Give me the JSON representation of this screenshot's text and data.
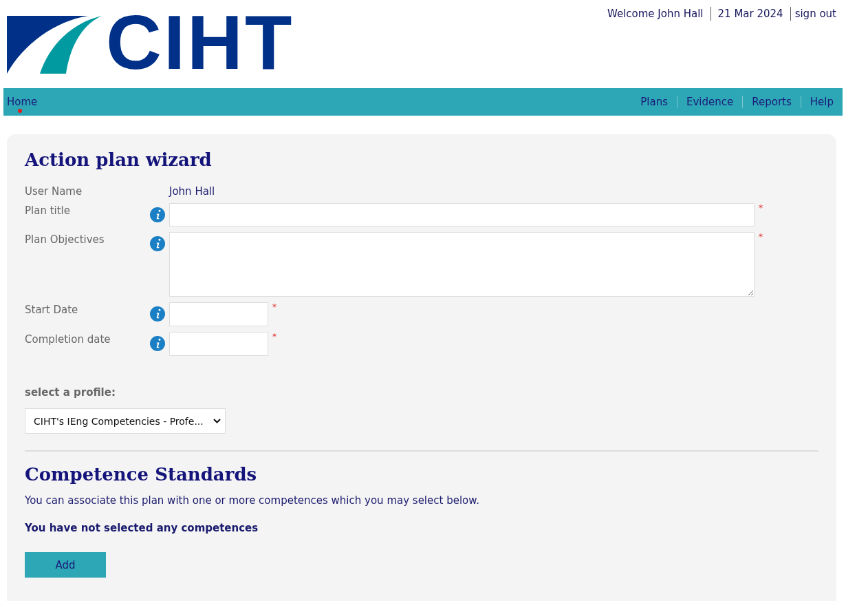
{
  "logo": {
    "text": "CIHT"
  },
  "header": {
    "welcome": "Welcome John Hall",
    "date": "21 Mar 2024",
    "sign_out": "sign out"
  },
  "nav": {
    "left": [
      {
        "label": "Home",
        "selected": true
      }
    ],
    "right": [
      {
        "label": "Plans",
        "selected": false
      },
      {
        "label": "Evidence",
        "selected": false
      },
      {
        "label": "Reports",
        "selected": false
      },
      {
        "label": "Help",
        "selected": false
      }
    ]
  },
  "form": {
    "title": "Action plan wizard",
    "user": {
      "label": "User Name",
      "value": "John Hall"
    },
    "fields": [
      {
        "label": "Plan title",
        "kind": "text",
        "required_mark": "*"
      },
      {
        "label": "Plan Objectives",
        "kind": "textarea",
        "required_mark": "*"
      },
      {
        "label": "Start Date",
        "kind": "date",
        "required_mark": "*"
      },
      {
        "label": "Completion date",
        "kind": "date",
        "required_mark": "*"
      }
    ],
    "profile": {
      "label": "select a profile:",
      "value": "CIHT's IEng Competencies - Profe..."
    }
  },
  "competence": {
    "title": "Competence Standards",
    "intro": "You can associate this plan with one or more competences which you may select below.",
    "status": "You have not selected any competences",
    "add_button": "Add"
  }
}
